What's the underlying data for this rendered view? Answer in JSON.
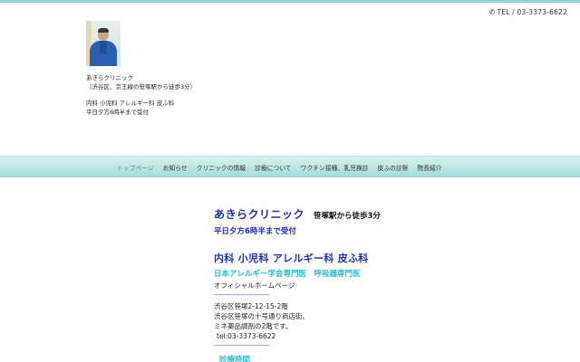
{
  "header": {
    "phone_icon": "phone-icon",
    "tel": "TEL / 03-3373-6622",
    "clinic_name": "あきらクリニック",
    "location": "（渋谷区、京王線の笹塚駅から徒歩3分）",
    "departments": "内科 小児科 アレルギー科 皮ふ科",
    "weekday_hours": "平日夕方6時半まで受付"
  },
  "nav": {
    "items": [
      {
        "label": "トップページ"
      },
      {
        "label": "お知らせ"
      },
      {
        "label": "クリニックの情報"
      },
      {
        "label": "診療について"
      },
      {
        "label": "ワクチン接種、乳児検診"
      },
      {
        "label": "皮ふの診察"
      },
      {
        "label": "院長紹介"
      }
    ]
  },
  "main": {
    "clinic_name": "あきらクリニック",
    "station": "笹塚駅から徒歩3分",
    "hours_note": "平日夕方6時半まで受付",
    "specialties": "内科 小児科 アレルギー科 皮ふ科",
    "certifications": "日本アレルギー学会専門医　呼吸器専門医",
    "official": "オフィシャルホームページ",
    "divider": "------------------------------",
    "address_lines": [
      "渋谷区笹塚2-12-15-2階",
      "渋谷区笹塚の十号通り商店街、",
      "ミネ薬品調剤の2階です。"
    ],
    "tel_line": "tel:03-3373-6622",
    "hours_heading": "診療時間"
  },
  "colors": {
    "accent_blue": "#1f2fb5",
    "accent_cyan": "#30bcd0",
    "nav_teal": "#a6dcd9"
  }
}
